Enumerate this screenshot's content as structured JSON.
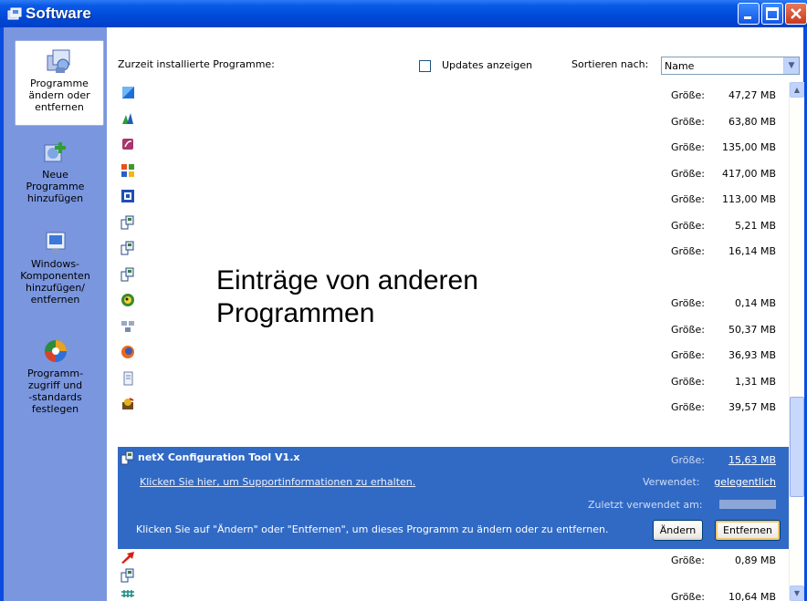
{
  "window": {
    "title": "Software",
    "icon": "software-window-icon"
  },
  "sidebar": {
    "items": [
      {
        "label_lines": [
          "Programme",
          "ändern oder",
          "entfernen"
        ],
        "icon": "programs-change-remove-icon",
        "active": true
      },
      {
        "label_lines": [
          "Neue",
          "Programme",
          "hinzufügen"
        ],
        "icon": "add-programs-icon",
        "active": false
      },
      {
        "label_lines": [
          "Windows-",
          "Komponenten",
          "hinzufügen/",
          "entfernen"
        ],
        "icon": "windows-components-icon",
        "active": false
      },
      {
        "label_lines": [
          "Programm-",
          "zugriff und",
          "-standards",
          "festlegen"
        ],
        "icon": "program-access-defaults-icon",
        "active": false
      }
    ]
  },
  "header": {
    "installed_label": "Zurzeit installierte Programme:",
    "updates_label": "Updates anzeigen",
    "sort_label": "Sortieren nach:",
    "sort_value": "Name"
  },
  "overlay_text": {
    "line1": "Einträge von anderen",
    "line2": "Programmen"
  },
  "list": {
    "size_label": "Größe:",
    "rows": [
      {
        "icon": "blue-square-app-icon",
        "size": "47,27 MB"
      },
      {
        "icon": "chart-app-icon",
        "size": "63,80 MB"
      },
      {
        "icon": "media-app-icon",
        "size": "135,00 MB"
      },
      {
        "icon": "office-app-icon",
        "size": "417,00 MB"
      },
      {
        "icon": "framework-app-icon",
        "size": "113,00 MB"
      },
      {
        "icon": "installer-icon",
        "size": "5,21 MB"
      },
      {
        "icon": "installer-icon",
        "size": "16,14 MB"
      },
      {
        "icon": "installer-icon",
        "size": ""
      },
      {
        "icon": "globe-app-icon",
        "size": "0,14 MB"
      },
      {
        "icon": "network-app-icon",
        "size": "50,37 MB"
      },
      {
        "icon": "firefox-icon",
        "size": "36,93 MB"
      },
      {
        "icon": "document-app-icon",
        "size": "1,31 MB"
      },
      {
        "icon": "tool-app-icon",
        "size": "39,57 MB"
      }
    ],
    "after_rows": [
      {
        "icon": "red-arrow-app-icon",
        "size": "0,89 MB"
      },
      {
        "icon": "installer-icon",
        "size": ""
      },
      {
        "icon": "teal-grid-app-icon",
        "size": "10,64 MB"
      }
    ]
  },
  "selected": {
    "icon": "installer-icon",
    "name": "netX Configuration Tool V1.x",
    "size_label": "Größe:",
    "size": "15,63 MB",
    "support_link": "Klicken Sie hier, um Supportinformationen zu erhalten.",
    "used_label": "Verwendet:",
    "used_value": "gelegentlich",
    "last_used_label": "Zuletzt verwendet am:",
    "instruction": "Klicken Sie auf \"Ändern\" oder \"Entfernen\", um dieses Programm zu ändern oder zu entfernen.",
    "change_button": "Ändern",
    "remove_button": "Entfernen"
  },
  "colors": {
    "titlebar": "#0A5AE6",
    "sidebar": "#7A96DF",
    "selection": "#316AC5"
  }
}
